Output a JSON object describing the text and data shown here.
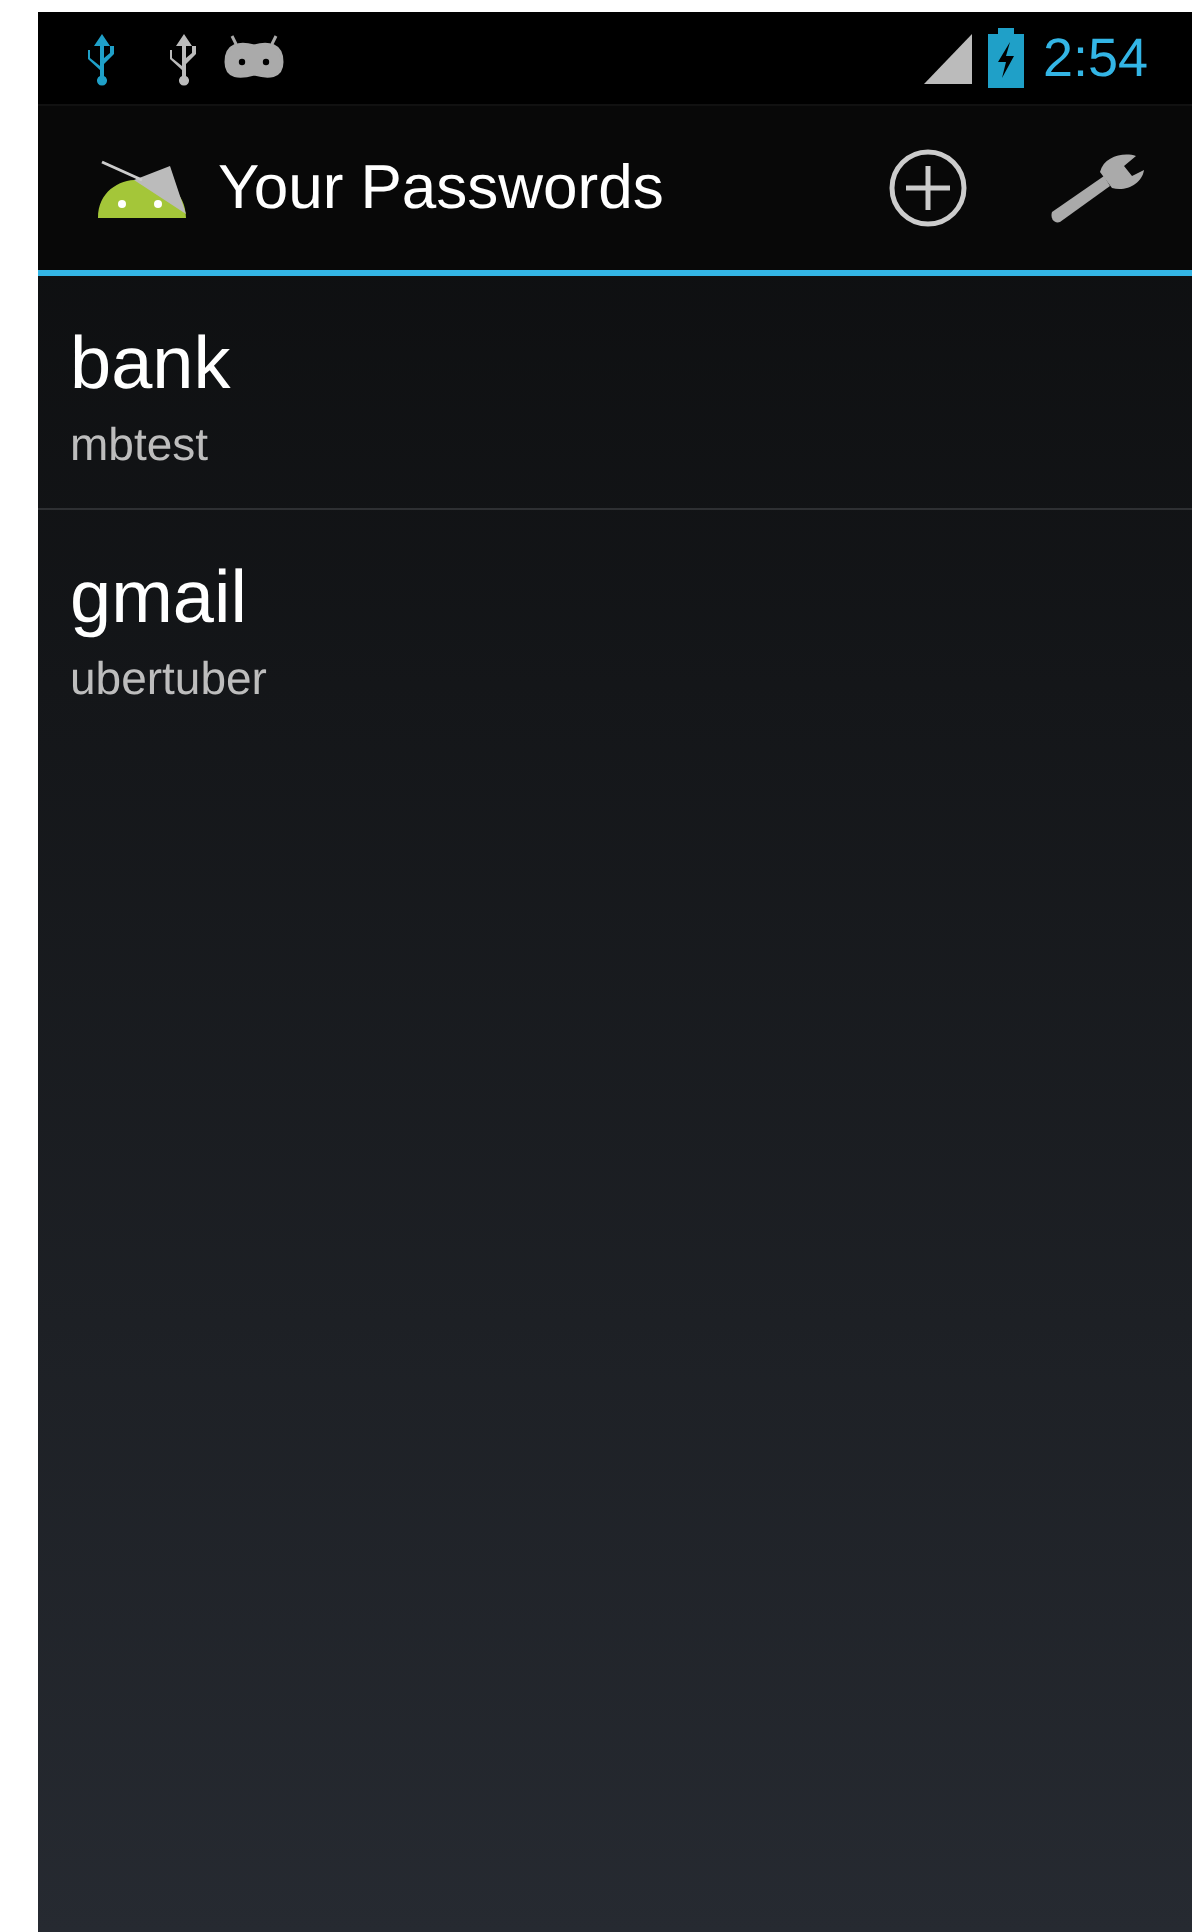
{
  "status_bar": {
    "time": "2:54"
  },
  "action_bar": {
    "title": "Your Passwords"
  },
  "passwords": [
    {
      "name": "bank",
      "username": "mbtest"
    },
    {
      "name": "gmail",
      "username": "ubertuber"
    }
  ]
}
